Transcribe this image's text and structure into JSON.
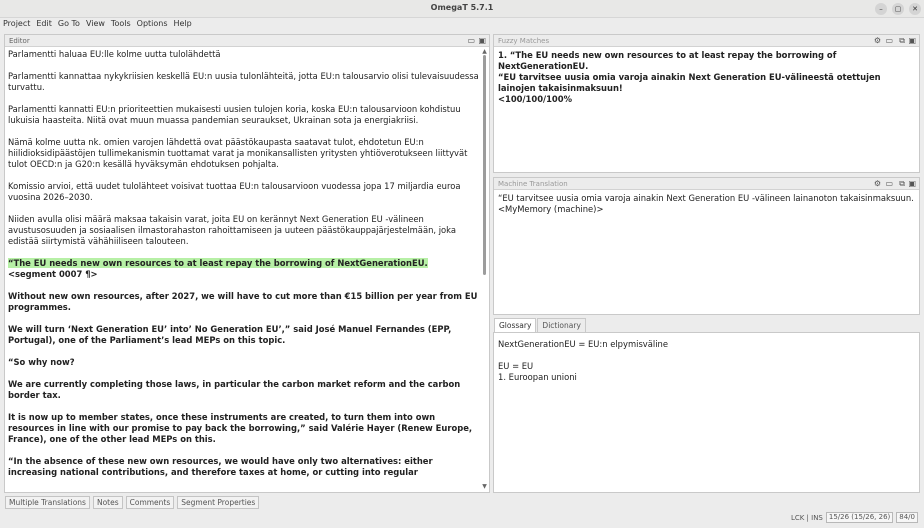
{
  "window": {
    "title": "OmegaT 5.7.1",
    "controls": {
      "minimize": "–",
      "maximize": "▢",
      "close": "✕"
    }
  },
  "menu": [
    "Project",
    "Edit",
    "Go To",
    "View",
    "Tools",
    "Options",
    "Help"
  ],
  "editor": {
    "title": "Editor",
    "paragraphs": [
      "Parlamentti haluaa EU:lle kolme uutta tulolähdettä",
      "Parlamentti kannattaa nykykriisien keskellä EU:n uusia tulonlähteitä, jotta EU:n talousarvio olisi tulevaisuudessa turvattu.",
      "Parlamentti kannatti EU:n prioriteettien mukaisesti uusien tulojen koria, koska EU:n talousarvioon kohdistuu lukuisia haasteita. Niitä ovat muun muassa pandemian seuraukset, Ukrainan sota ja energiakriisi.",
      "Nämä kolme uutta nk. omien varojen lähdettä ovat päästökaupasta saatavat tulot, ehdotetun EU:n hiilidioksidipäästöjen tullimekanismin tuottamat varat ja monikansallisten yritysten yhtiöverotukseen liittyvät tulot OECD:n ja G20:n kesällä hyväksymän ehdotuksen pohjalta.",
      "Komissio arvioi, että uudet tulolähteet voisivat tuottaa EU:n talousarvioon vuodessa jopa 17 miljardia euroa vuosina 2026–2030.",
      "Niiden avulla olisi määrä maksaa takaisin varat, joita EU on kerännyt Next Generation EU -välineen avustusosuuden ja sosiaalisen ilmastorahaston rahoittamiseen ja uuteen päästökauppajärjestelmään, joka edistää siirtymistä vähähiiliseen talouteen."
    ],
    "active_segment": {
      "text": "“The EU needs new own resources to at least repay the borrowing of NextGenerationEU.",
      "marker": "<segment 0007 ¶>"
    },
    "source_paragraphs": [
      "Without new own resources, after 2027, we will have to cut more than €15 billion per year from EU programmes.",
      "We will turn ‘Next Generation EU’ into’ No Generation EU’,” said José Manuel Fernandes (EPP, Portugal), one of the Parliament’s lead MEPs on this topic.",
      "“So why now?",
      "We are currently completing those laws, in particular the carbon market reform and the carbon border tax.",
      "It is now up to member states, once these instruments are created, to turn them into own resources in line with our promise to pay back the borrowing,” said Valérie Hayer (Renew Europe, France), one of the other lead MEPs on this.",
      "“In the absence of these new own resources, we would have only two alternatives: either increasing national contributions, and therefore taxes at home, or cutting into regular"
    ]
  },
  "fuzzy": {
    "title": "Fuzzy Matches",
    "line1": "1. “The EU needs new own resources to at least repay the borrowing of NextGenerationEU.",
    "line2": "“EU tarvitsee uusia omia varoja ainakin Next Generation EU-välineestä otettujen lainojen takaisinmaksuun!",
    "line3": "<100/100/100%"
  },
  "mt": {
    "title": "Machine Translation",
    "line1": "“EU tarvitsee uusia omia varoja ainakin Next Generation EU -välineen lainanoton takaisinmaksuun.",
    "line2": "<MyMemory (machine)>"
  },
  "tabs": {
    "glossary": "Glossary",
    "dictionary": "Dictionary"
  },
  "glossary": {
    "line1": "NextGenerationEU = EU:n elpymisväline",
    "line2": "EU = EU",
    "line3": "1. Euroopan unioni"
  },
  "bottom_tabs": [
    "Multiple Translations",
    "Notes",
    "Comments",
    "Segment Properties"
  ],
  "status": {
    "lck_ins": "LCK | INS",
    "progress": "15/26 (15/26, 26)",
    "chars": "84/0"
  },
  "colors": {
    "highlight": "#b7f0a6"
  }
}
